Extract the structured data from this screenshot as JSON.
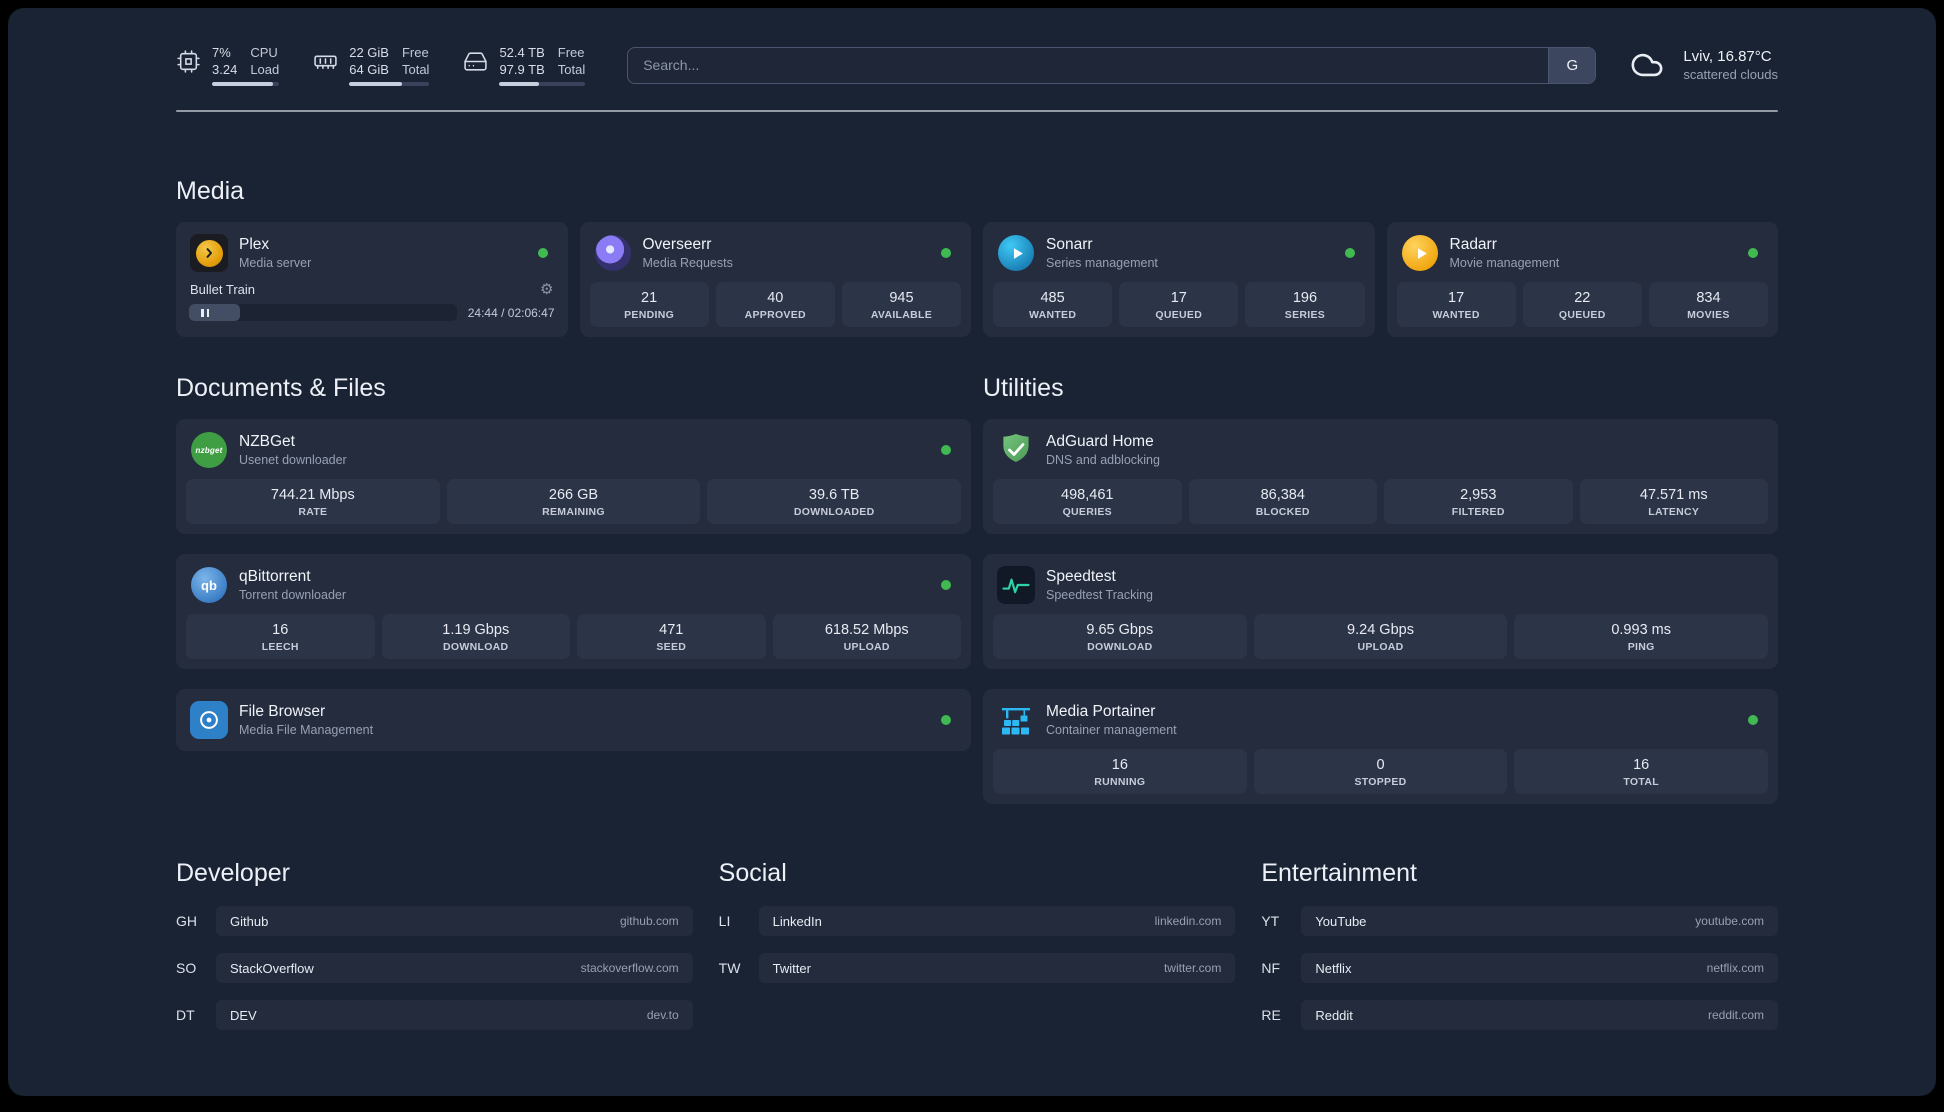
{
  "theme": {
    "page_bg": "#1a2333",
    "card_bg": "#242c3e",
    "tile_bg": "#2c3447",
    "status_online": "#3fb950",
    "text_primary": "#eef1f7",
    "text_muted": "#98a1b4"
  },
  "topbar": {
    "resources": [
      {
        "line1_value": "7%",
        "line2_value": "3.24",
        "line1_label": "CPU",
        "line2_label": "Load",
        "percent": 90
      },
      {
        "line1_value": "22 GiB",
        "line2_value": "64 GiB",
        "line1_label": "Free",
        "line2_label": "Total",
        "percent": 66
      },
      {
        "line1_value": "52.4 TB",
        "line2_value": "97.9 TB",
        "line1_label": "Free",
        "line2_label": "Total",
        "percent": 46
      }
    ],
    "search": {
      "placeholder": "Search...",
      "button_label": "G"
    },
    "weather": {
      "location": "Lviv, 16.87°C",
      "condition": "scattered clouds"
    }
  },
  "sections": {
    "media": {
      "title": "Media",
      "cards": [
        {
          "name": "Plex",
          "desc": "Media server",
          "player": {
            "title": "Bullet Train",
            "time": "24:44 / 02:06:47",
            "progress_percent": 19
          }
        },
        {
          "name": "Overseerr",
          "desc": "Media Requests",
          "stats": [
            {
              "value": "21",
              "label": "PENDING"
            },
            {
              "value": "40",
              "label": "APPROVED"
            },
            {
              "value": "945",
              "label": "AVAILABLE"
            }
          ]
        },
        {
          "name": "Sonarr",
          "desc": "Series management",
          "stats": [
            {
              "value": "485",
              "label": "WANTED"
            },
            {
              "value": "17",
              "label": "QUEUED"
            },
            {
              "value": "196",
              "label": "SERIES"
            }
          ]
        },
        {
          "name": "Radarr",
          "desc": "Movie management",
          "stats": [
            {
              "value": "17",
              "label": "WANTED"
            },
            {
              "value": "22",
              "label": "QUEUED"
            },
            {
              "value": "834",
              "label": "MOVIES"
            }
          ]
        }
      ]
    },
    "documents": {
      "title": "Documents & Files",
      "cards": [
        {
          "name": "NZBGet",
          "desc": "Usenet downloader",
          "stats": [
            {
              "value": "744.21 Mbps",
              "label": "RATE"
            },
            {
              "value": "266 GB",
              "label": "REMAINING"
            },
            {
              "value": "39.6 TB",
              "label": "DOWNLOADED"
            }
          ]
        },
        {
          "name": "qBittorrent",
          "desc": "Torrent downloader",
          "stats": [
            {
              "value": "16",
              "label": "LEECH"
            },
            {
              "value": "1.19 Gbps",
              "label": "DOWNLOAD"
            },
            {
              "value": "471",
              "label": "SEED"
            },
            {
              "value": "618.52 Mbps",
              "label": "UPLOAD"
            }
          ]
        },
        {
          "name": "File Browser",
          "desc": "Media File Management",
          "stats": []
        }
      ]
    },
    "utilities": {
      "title": "Utilities",
      "cards": [
        {
          "name": "AdGuard Home",
          "desc": "DNS and adblocking",
          "stats": [
            {
              "value": "498,461",
              "label": "QUERIES"
            },
            {
              "value": "86,384",
              "label": "BLOCKED"
            },
            {
              "value": "2,953",
              "label": "FILTERED"
            },
            {
              "value": "47.571 ms",
              "label": "LATENCY"
            }
          ]
        },
        {
          "name": "Speedtest",
          "desc": "Speedtest Tracking",
          "stats": [
            {
              "value": "9.65 Gbps",
              "label": "DOWNLOAD"
            },
            {
              "value": "9.24 Gbps",
              "label": "UPLOAD"
            },
            {
              "value": "0.993 ms",
              "label": "PING"
            }
          ]
        },
        {
          "name": "Media Portainer",
          "desc": "Container management",
          "stats": [
            {
              "value": "16",
              "label": "RUNNING"
            },
            {
              "value": "0",
              "label": "STOPPED"
            },
            {
              "value": "16",
              "label": "TOTAL"
            }
          ]
        }
      ]
    },
    "bookmarks": [
      {
        "title": "Developer",
        "items": [
          {
            "abbr": "GH",
            "name": "Github",
            "domain": "github.com"
          },
          {
            "abbr": "SO",
            "name": "StackOverflow",
            "domain": "stackoverflow.com"
          },
          {
            "abbr": "DT",
            "name": "DEV",
            "domain": "dev.to"
          }
        ]
      },
      {
        "title": "Social",
        "items": [
          {
            "abbr": "LI",
            "name": "LinkedIn",
            "domain": "linkedin.com"
          },
          {
            "abbr": "TW",
            "name": "Twitter",
            "domain": "twitter.com"
          }
        ]
      },
      {
        "title": "Entertainment",
        "items": [
          {
            "abbr": "YT",
            "name": "YouTube",
            "domain": "youtube.com"
          },
          {
            "abbr": "NF",
            "name": "Netflix",
            "domain": "netflix.com"
          },
          {
            "abbr": "RE",
            "name": "Reddit",
            "domain": "reddit.com"
          }
        ]
      }
    ]
  }
}
